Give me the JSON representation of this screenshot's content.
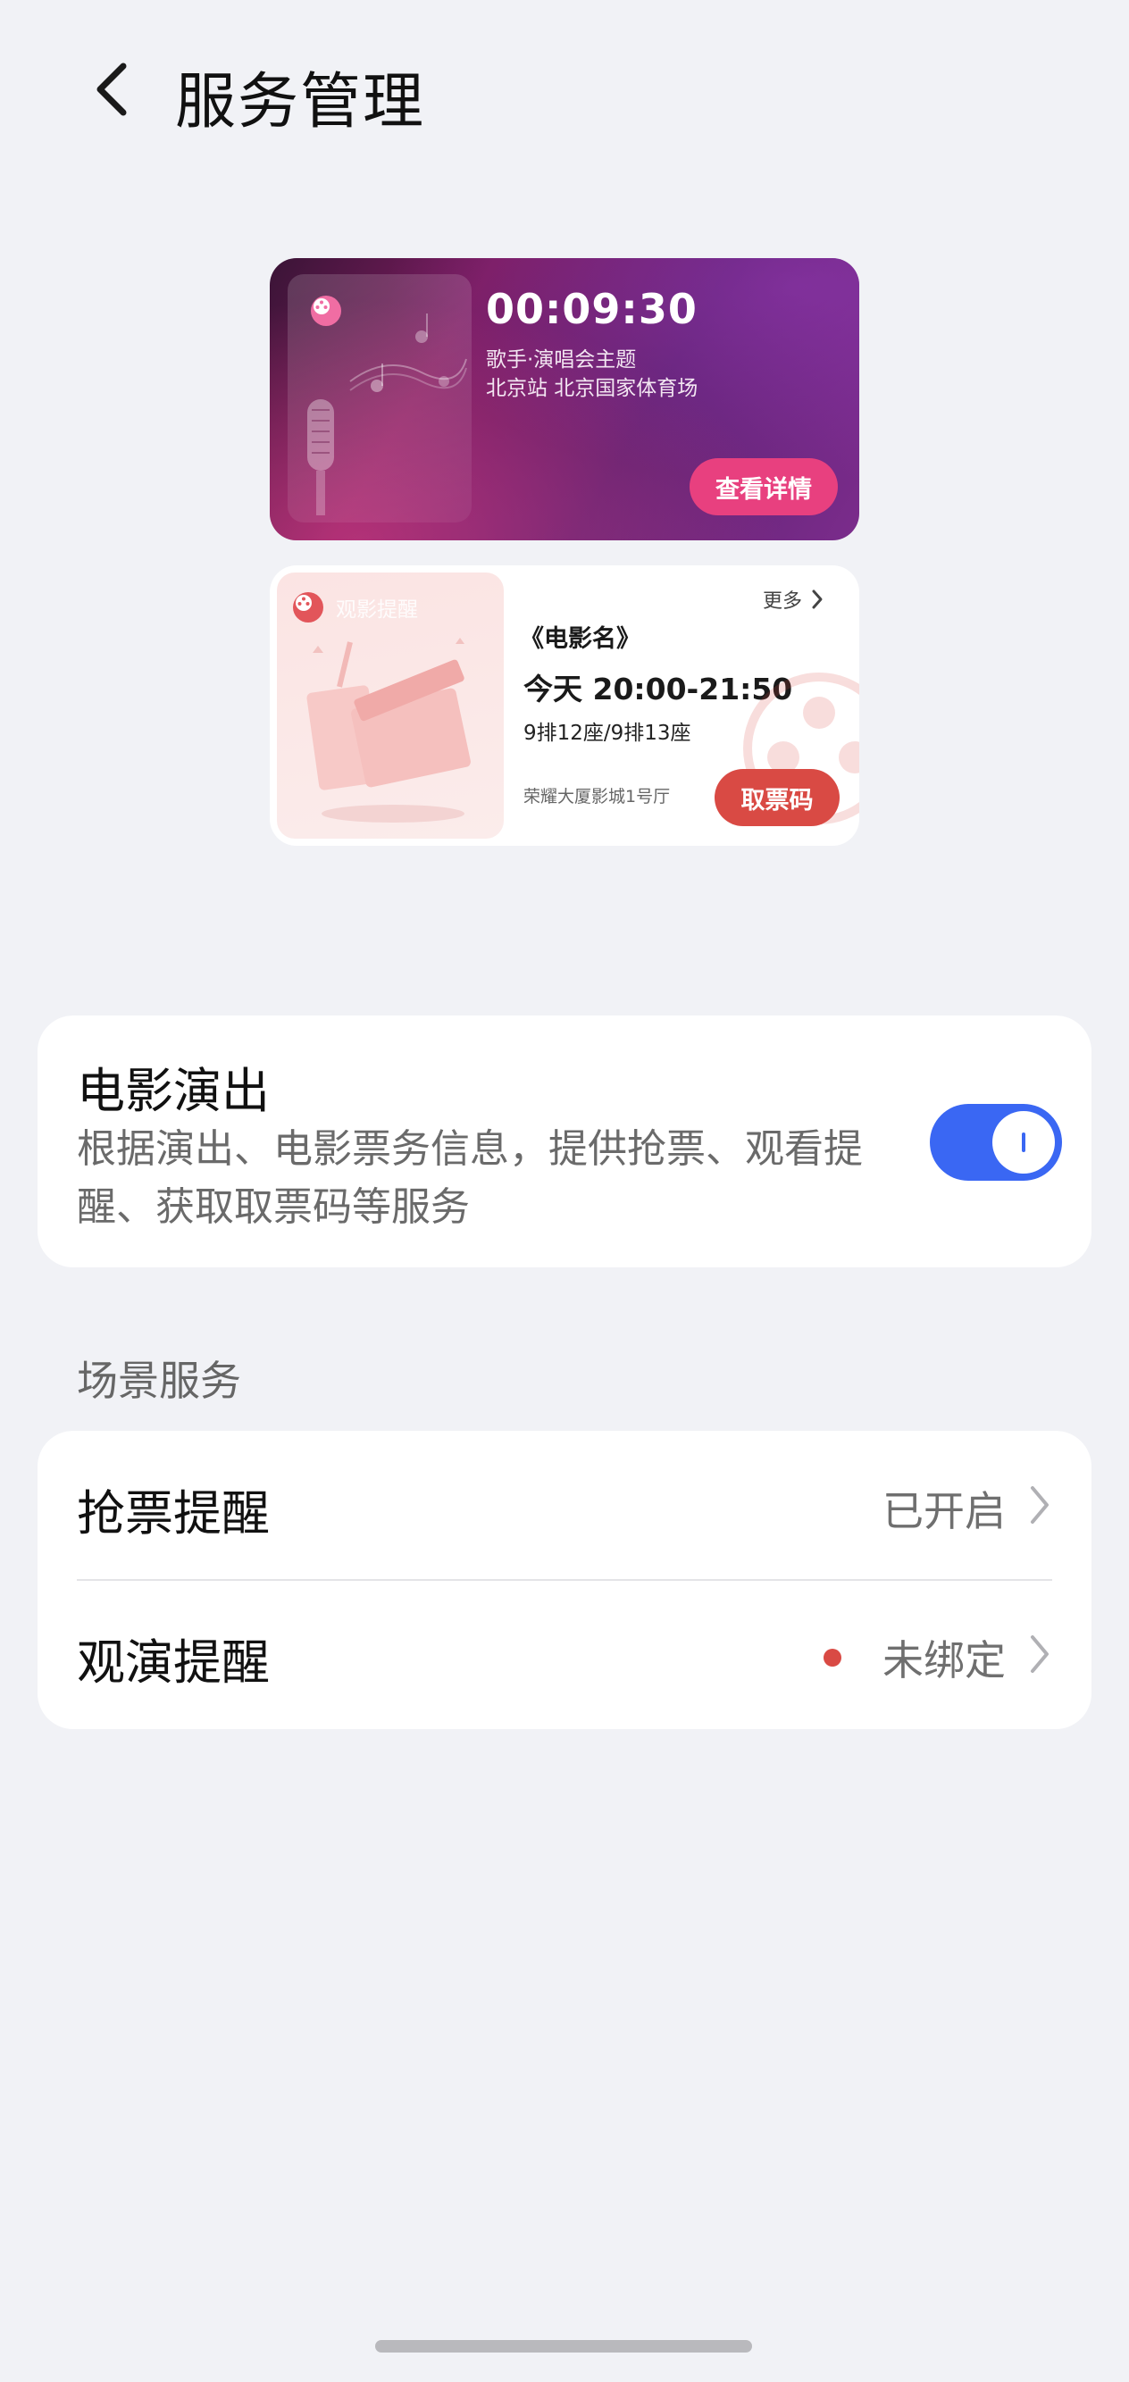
{
  "header": {
    "title": "服务管理"
  },
  "preview": {
    "concert": {
      "countdown": "00:09:30",
      "subtitle": "歌手·演唱会主题",
      "venue": "北京站 北京国家体育场",
      "button_label": "查看详情"
    },
    "movie": {
      "tag": "观影提醒",
      "more_label": "更多",
      "name": "《电影名》",
      "time": "今天 20:00-21:50",
      "seats": "9排12座/9排13座",
      "cinema": "荣耀大厦影城1号厅",
      "button_label": "取票码"
    }
  },
  "service": {
    "title": "电影演出",
    "description": "根据演出、电影票务信息，提供抢票、观看提醒、获取取票码等服务",
    "enabled": true
  },
  "scene": {
    "section_label": "场景服务",
    "rows": [
      {
        "label": "抢票提醒",
        "value": "已开启",
        "dot": false
      },
      {
        "label": "观演提醒",
        "value": "未绑定",
        "dot": true
      }
    ]
  },
  "colors": {
    "accent_blue": "#3a67f3",
    "alert_red": "#d94a44",
    "concert_pink": "#e8407f"
  }
}
